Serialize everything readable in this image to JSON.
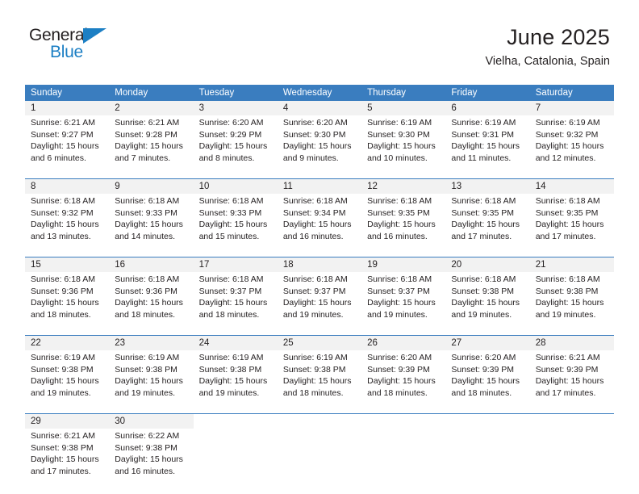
{
  "brand": {
    "name_top": "General",
    "name_bottom": "Blue"
  },
  "header": {
    "title": "June 2025",
    "location": "Vielha, Catalonia, Spain"
  },
  "theme": {
    "header_blue": "#3a7dbf",
    "daynum_gray": "#f2f2f2",
    "logo_blue": "#1c7fc4",
    "text": "#231f20"
  },
  "weekday_headers": [
    "Sunday",
    "Monday",
    "Tuesday",
    "Wednesday",
    "Thursday",
    "Friday",
    "Saturday"
  ],
  "weeks": [
    [
      {
        "day": "1",
        "sunrise": "Sunrise: 6:21 AM",
        "sunset": "Sunset: 9:27 PM",
        "daylight1": "Daylight: 15 hours",
        "daylight2": "and 6 minutes."
      },
      {
        "day": "2",
        "sunrise": "Sunrise: 6:21 AM",
        "sunset": "Sunset: 9:28 PM",
        "daylight1": "Daylight: 15 hours",
        "daylight2": "and 7 minutes."
      },
      {
        "day": "3",
        "sunrise": "Sunrise: 6:20 AM",
        "sunset": "Sunset: 9:29 PM",
        "daylight1": "Daylight: 15 hours",
        "daylight2": "and 8 minutes."
      },
      {
        "day": "4",
        "sunrise": "Sunrise: 6:20 AM",
        "sunset": "Sunset: 9:30 PM",
        "daylight1": "Daylight: 15 hours",
        "daylight2": "and 9 minutes."
      },
      {
        "day": "5",
        "sunrise": "Sunrise: 6:19 AM",
        "sunset": "Sunset: 9:30 PM",
        "daylight1": "Daylight: 15 hours",
        "daylight2": "and 10 minutes."
      },
      {
        "day": "6",
        "sunrise": "Sunrise: 6:19 AM",
        "sunset": "Sunset: 9:31 PM",
        "daylight1": "Daylight: 15 hours",
        "daylight2": "and 11 minutes."
      },
      {
        "day": "7",
        "sunrise": "Sunrise: 6:19 AM",
        "sunset": "Sunset: 9:32 PM",
        "daylight1": "Daylight: 15 hours",
        "daylight2": "and 12 minutes."
      }
    ],
    [
      {
        "day": "8",
        "sunrise": "Sunrise: 6:18 AM",
        "sunset": "Sunset: 9:32 PM",
        "daylight1": "Daylight: 15 hours",
        "daylight2": "and 13 minutes."
      },
      {
        "day": "9",
        "sunrise": "Sunrise: 6:18 AM",
        "sunset": "Sunset: 9:33 PM",
        "daylight1": "Daylight: 15 hours",
        "daylight2": "and 14 minutes."
      },
      {
        "day": "10",
        "sunrise": "Sunrise: 6:18 AM",
        "sunset": "Sunset: 9:33 PM",
        "daylight1": "Daylight: 15 hours",
        "daylight2": "and 15 minutes."
      },
      {
        "day": "11",
        "sunrise": "Sunrise: 6:18 AM",
        "sunset": "Sunset: 9:34 PM",
        "daylight1": "Daylight: 15 hours",
        "daylight2": "and 16 minutes."
      },
      {
        "day": "12",
        "sunrise": "Sunrise: 6:18 AM",
        "sunset": "Sunset: 9:35 PM",
        "daylight1": "Daylight: 15 hours",
        "daylight2": "and 16 minutes."
      },
      {
        "day": "13",
        "sunrise": "Sunrise: 6:18 AM",
        "sunset": "Sunset: 9:35 PM",
        "daylight1": "Daylight: 15 hours",
        "daylight2": "and 17 minutes."
      },
      {
        "day": "14",
        "sunrise": "Sunrise: 6:18 AM",
        "sunset": "Sunset: 9:35 PM",
        "daylight1": "Daylight: 15 hours",
        "daylight2": "and 17 minutes."
      }
    ],
    [
      {
        "day": "15",
        "sunrise": "Sunrise: 6:18 AM",
        "sunset": "Sunset: 9:36 PM",
        "daylight1": "Daylight: 15 hours",
        "daylight2": "and 18 minutes."
      },
      {
        "day": "16",
        "sunrise": "Sunrise: 6:18 AM",
        "sunset": "Sunset: 9:36 PM",
        "daylight1": "Daylight: 15 hours",
        "daylight2": "and 18 minutes."
      },
      {
        "day": "17",
        "sunrise": "Sunrise: 6:18 AM",
        "sunset": "Sunset: 9:37 PM",
        "daylight1": "Daylight: 15 hours",
        "daylight2": "and 18 minutes."
      },
      {
        "day": "18",
        "sunrise": "Sunrise: 6:18 AM",
        "sunset": "Sunset: 9:37 PM",
        "daylight1": "Daylight: 15 hours",
        "daylight2": "and 19 minutes."
      },
      {
        "day": "19",
        "sunrise": "Sunrise: 6:18 AM",
        "sunset": "Sunset: 9:37 PM",
        "daylight1": "Daylight: 15 hours",
        "daylight2": "and 19 minutes."
      },
      {
        "day": "20",
        "sunrise": "Sunrise: 6:18 AM",
        "sunset": "Sunset: 9:38 PM",
        "daylight1": "Daylight: 15 hours",
        "daylight2": "and 19 minutes."
      },
      {
        "day": "21",
        "sunrise": "Sunrise: 6:18 AM",
        "sunset": "Sunset: 9:38 PM",
        "daylight1": "Daylight: 15 hours",
        "daylight2": "and 19 minutes."
      }
    ],
    [
      {
        "day": "22",
        "sunrise": "Sunrise: 6:19 AM",
        "sunset": "Sunset: 9:38 PM",
        "daylight1": "Daylight: 15 hours",
        "daylight2": "and 19 minutes."
      },
      {
        "day": "23",
        "sunrise": "Sunrise: 6:19 AM",
        "sunset": "Sunset: 9:38 PM",
        "daylight1": "Daylight: 15 hours",
        "daylight2": "and 19 minutes."
      },
      {
        "day": "24",
        "sunrise": "Sunrise: 6:19 AM",
        "sunset": "Sunset: 9:38 PM",
        "daylight1": "Daylight: 15 hours",
        "daylight2": "and 19 minutes."
      },
      {
        "day": "25",
        "sunrise": "Sunrise: 6:19 AM",
        "sunset": "Sunset: 9:38 PM",
        "daylight1": "Daylight: 15 hours",
        "daylight2": "and 18 minutes."
      },
      {
        "day": "26",
        "sunrise": "Sunrise: 6:20 AM",
        "sunset": "Sunset: 9:39 PM",
        "daylight1": "Daylight: 15 hours",
        "daylight2": "and 18 minutes."
      },
      {
        "day": "27",
        "sunrise": "Sunrise: 6:20 AM",
        "sunset": "Sunset: 9:39 PM",
        "daylight1": "Daylight: 15 hours",
        "daylight2": "and 18 minutes."
      },
      {
        "day": "28",
        "sunrise": "Sunrise: 6:21 AM",
        "sunset": "Sunset: 9:39 PM",
        "daylight1": "Daylight: 15 hours",
        "daylight2": "and 17 minutes."
      }
    ],
    [
      {
        "day": "29",
        "sunrise": "Sunrise: 6:21 AM",
        "sunset": "Sunset: 9:38 PM",
        "daylight1": "Daylight: 15 hours",
        "daylight2": "and 17 minutes."
      },
      {
        "day": "30",
        "sunrise": "Sunrise: 6:22 AM",
        "sunset": "Sunset: 9:38 PM",
        "daylight1": "Daylight: 15 hours",
        "daylight2": "and 16 minutes."
      },
      {
        "day": "",
        "sunrise": "",
        "sunset": "",
        "daylight1": "",
        "daylight2": ""
      },
      {
        "day": "",
        "sunrise": "",
        "sunset": "",
        "daylight1": "",
        "daylight2": ""
      },
      {
        "day": "",
        "sunrise": "",
        "sunset": "",
        "daylight1": "",
        "daylight2": ""
      },
      {
        "day": "",
        "sunrise": "",
        "sunset": "",
        "daylight1": "",
        "daylight2": ""
      },
      {
        "day": "",
        "sunrise": "",
        "sunset": "",
        "daylight1": "",
        "daylight2": ""
      }
    ]
  ]
}
